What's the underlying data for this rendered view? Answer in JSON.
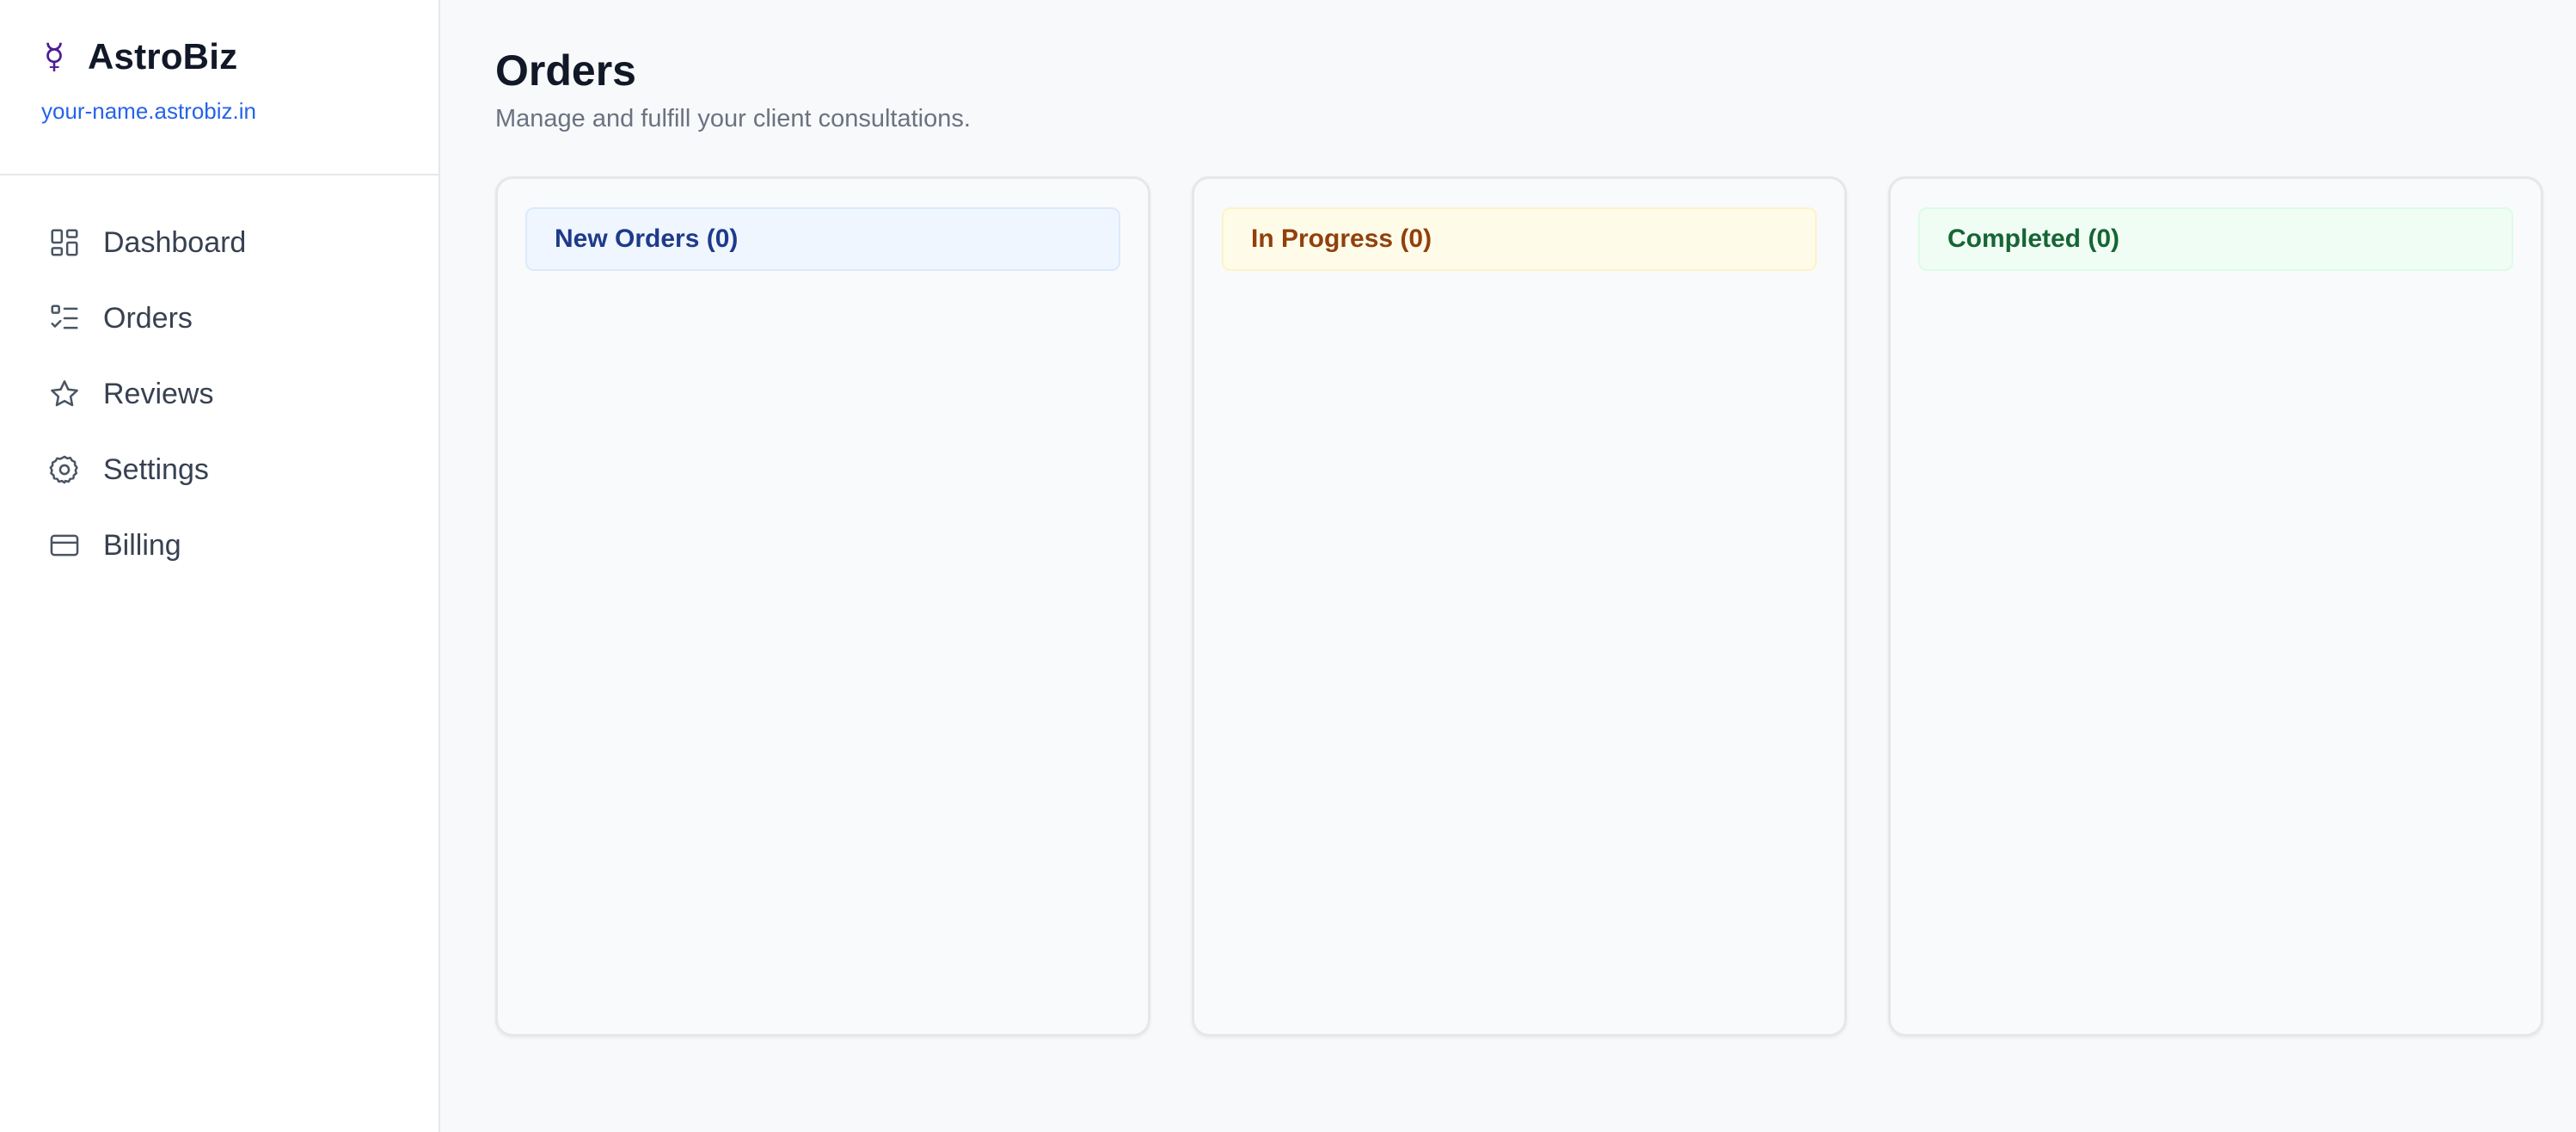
{
  "brand": {
    "glyph": "☿",
    "name": "AstroBiz",
    "url": "your-name.astrobiz.in"
  },
  "nav": {
    "items": [
      {
        "label": "Dashboard",
        "icon": "dashboard-grid-icon"
      },
      {
        "label": "Orders",
        "icon": "checklist-icon"
      },
      {
        "label": "Reviews",
        "icon": "star-icon"
      },
      {
        "label": "Settings",
        "icon": "gear-icon"
      },
      {
        "label": "Billing",
        "icon": "credit-card-icon"
      }
    ]
  },
  "page": {
    "title": "Orders",
    "subtitle": "Manage and fulfill your client consultations."
  },
  "board": {
    "columns": [
      {
        "label": "New Orders (0)",
        "color": "#1e3a8a",
        "background": "#eff6ff"
      },
      {
        "label": "In Progress (0)",
        "color": "#92400e",
        "background": "#fefce8"
      },
      {
        "label": "Completed (0)",
        "color": "#166534",
        "background": "#f0fdf4"
      }
    ]
  },
  "colors": {
    "link": "#2563eb",
    "icon": "#4b5563"
  }
}
